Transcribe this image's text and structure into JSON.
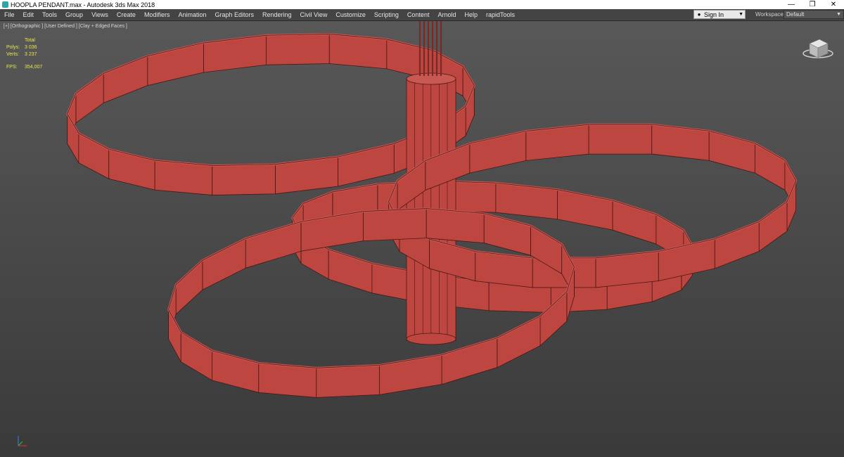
{
  "titlebar": {
    "title": "HOOPLA PENDANT.max - Autodesk 3ds Max 2018",
    "minimize_icon": "minimize-icon",
    "restore_icon": "restore-icon",
    "close_icon": "close-icon"
  },
  "menubar": {
    "items": [
      "File",
      "Edit",
      "Tools",
      "Group",
      "Views",
      "Create",
      "Modifiers",
      "Animation",
      "Graph Editors",
      "Rendering",
      "Civil View",
      "Customize",
      "Scripting",
      "Content",
      "Arnold",
      "Help",
      "rapidTools"
    ],
    "sign_in": "Sign In",
    "workspaces_label": "Workspaces:",
    "workspace_value": "Default"
  },
  "viewport": {
    "label": "[+] [Orthographic ] [User Defined ] [Clay + Edged Faces ]",
    "stats": {
      "total_header": "Total",
      "polys_label": "Polys:",
      "polys_value": "3 036",
      "verts_label": "Verts:",
      "verts_value": "3 237",
      "fps_label": "FPS:",
      "fps_value": "354,007"
    },
    "colors": {
      "ring_face": "#bd4740",
      "ring_top": "#c75550",
      "edge": "#4a1613",
      "background_top": "#585858",
      "background_bottom": "#3a3a3a"
    }
  }
}
